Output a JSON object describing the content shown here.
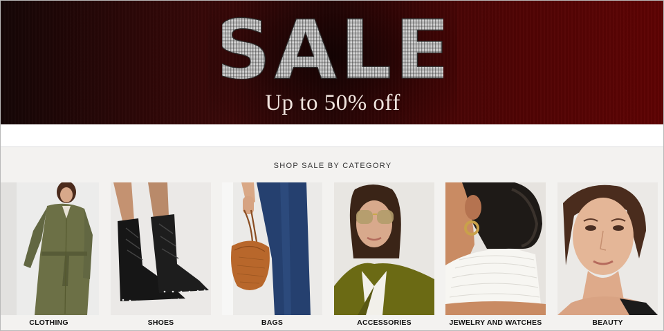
{
  "hero": {
    "title": "SALE",
    "subtitle": "Up  to 50% off"
  },
  "section": {
    "heading": "SHOP SALE BY CATEGORY"
  },
  "categories": [
    {
      "label": "CLOTHING",
      "icon": "woman-in-trench-coat"
    },
    {
      "label": "SHOES",
      "icon": "black-lace-up-boots"
    },
    {
      "label": "BAGS",
      "icon": "tan-handbag"
    },
    {
      "label": "ACCESSORIES",
      "icon": "woman-with-sunglasses"
    },
    {
      "label": "JEWELRY AND WATCHES",
      "icon": "gold-hoop-earring"
    },
    {
      "label": "BEAUTY",
      "icon": "woman-face-portrait"
    }
  ],
  "colors": {
    "banner_dark": "#150606",
    "banner_red": "#5f0303",
    "section_bg": "#f3f2f0",
    "label_text": "#111111"
  }
}
